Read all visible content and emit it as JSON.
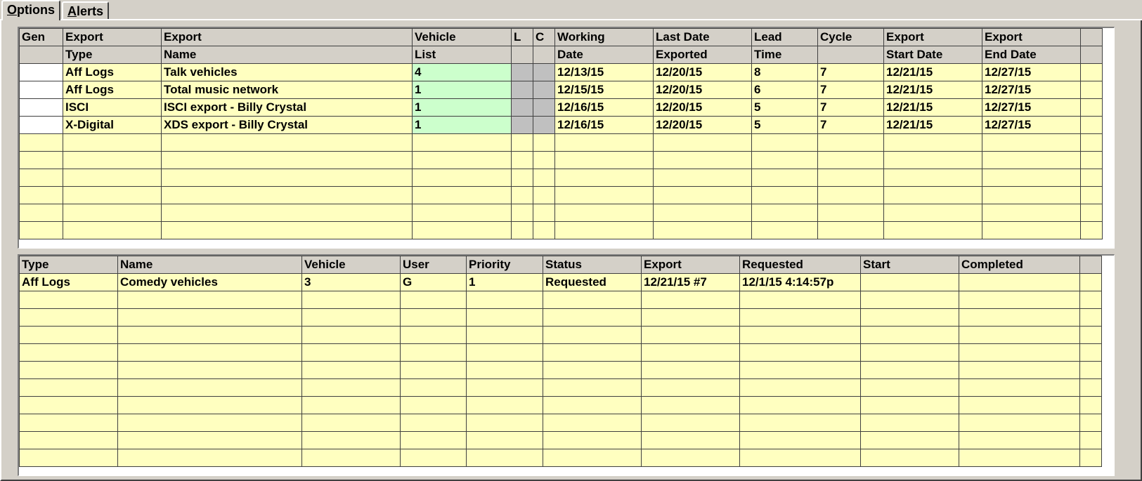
{
  "tabs": [
    {
      "label": "Options",
      "accel": "O",
      "rest": "ptions"
    },
    {
      "label": "Alerts",
      "accel": "A",
      "rest": "lerts"
    }
  ],
  "export_grid": {
    "header_row1": [
      "Gen",
      "Export",
      "Export",
      "Vehicle",
      "L",
      "C",
      "Working",
      "Last Date",
      "Lead",
      "Cycle",
      "Export",
      "Export",
      ""
    ],
    "header_row2": [
      "",
      "Type",
      "Name",
      "List",
      "",
      "",
      "Date",
      "Exported",
      "Time",
      "",
      "Start Date",
      "End Date",
      ""
    ],
    "rows": [
      [
        "",
        "Aff Logs",
        "Talk vehicles",
        "4",
        "",
        "",
        "12/13/15",
        "12/20/15",
        "8",
        "7",
        "12/21/15",
        "12/27/15",
        ""
      ],
      [
        "",
        "Aff Logs",
        "Total music network",
        "1",
        "",
        "",
        "12/15/15",
        "12/20/15",
        "6",
        "7",
        "12/21/15",
        "12/27/15",
        ""
      ],
      [
        "",
        "ISCI",
        "ISCI export - Billy Crystal",
        "1",
        "",
        "",
        "12/16/15",
        "12/20/15",
        "5",
        "7",
        "12/21/15",
        "12/27/15",
        ""
      ],
      [
        "",
        "X-Digital",
        "XDS export - Billy Crystal",
        "1",
        "",
        "",
        "12/16/15",
        "12/20/15",
        "5",
        "7",
        "12/21/15",
        "12/27/15",
        ""
      ]
    ]
  },
  "queue_grid": {
    "headers": [
      "Type",
      "Name",
      "Vehicle",
      "User",
      "Priority",
      "Status",
      "Export",
      "Requested",
      "Start",
      "Completed",
      ""
    ],
    "rows": [
      [
        "Aff Logs",
        "Comedy vehicles",
        "3",
        "G",
        "1",
        "Requested",
        "12/21/15 #7",
        "12/1/15 4:14:57p",
        "",
        "",
        ""
      ]
    ]
  }
}
